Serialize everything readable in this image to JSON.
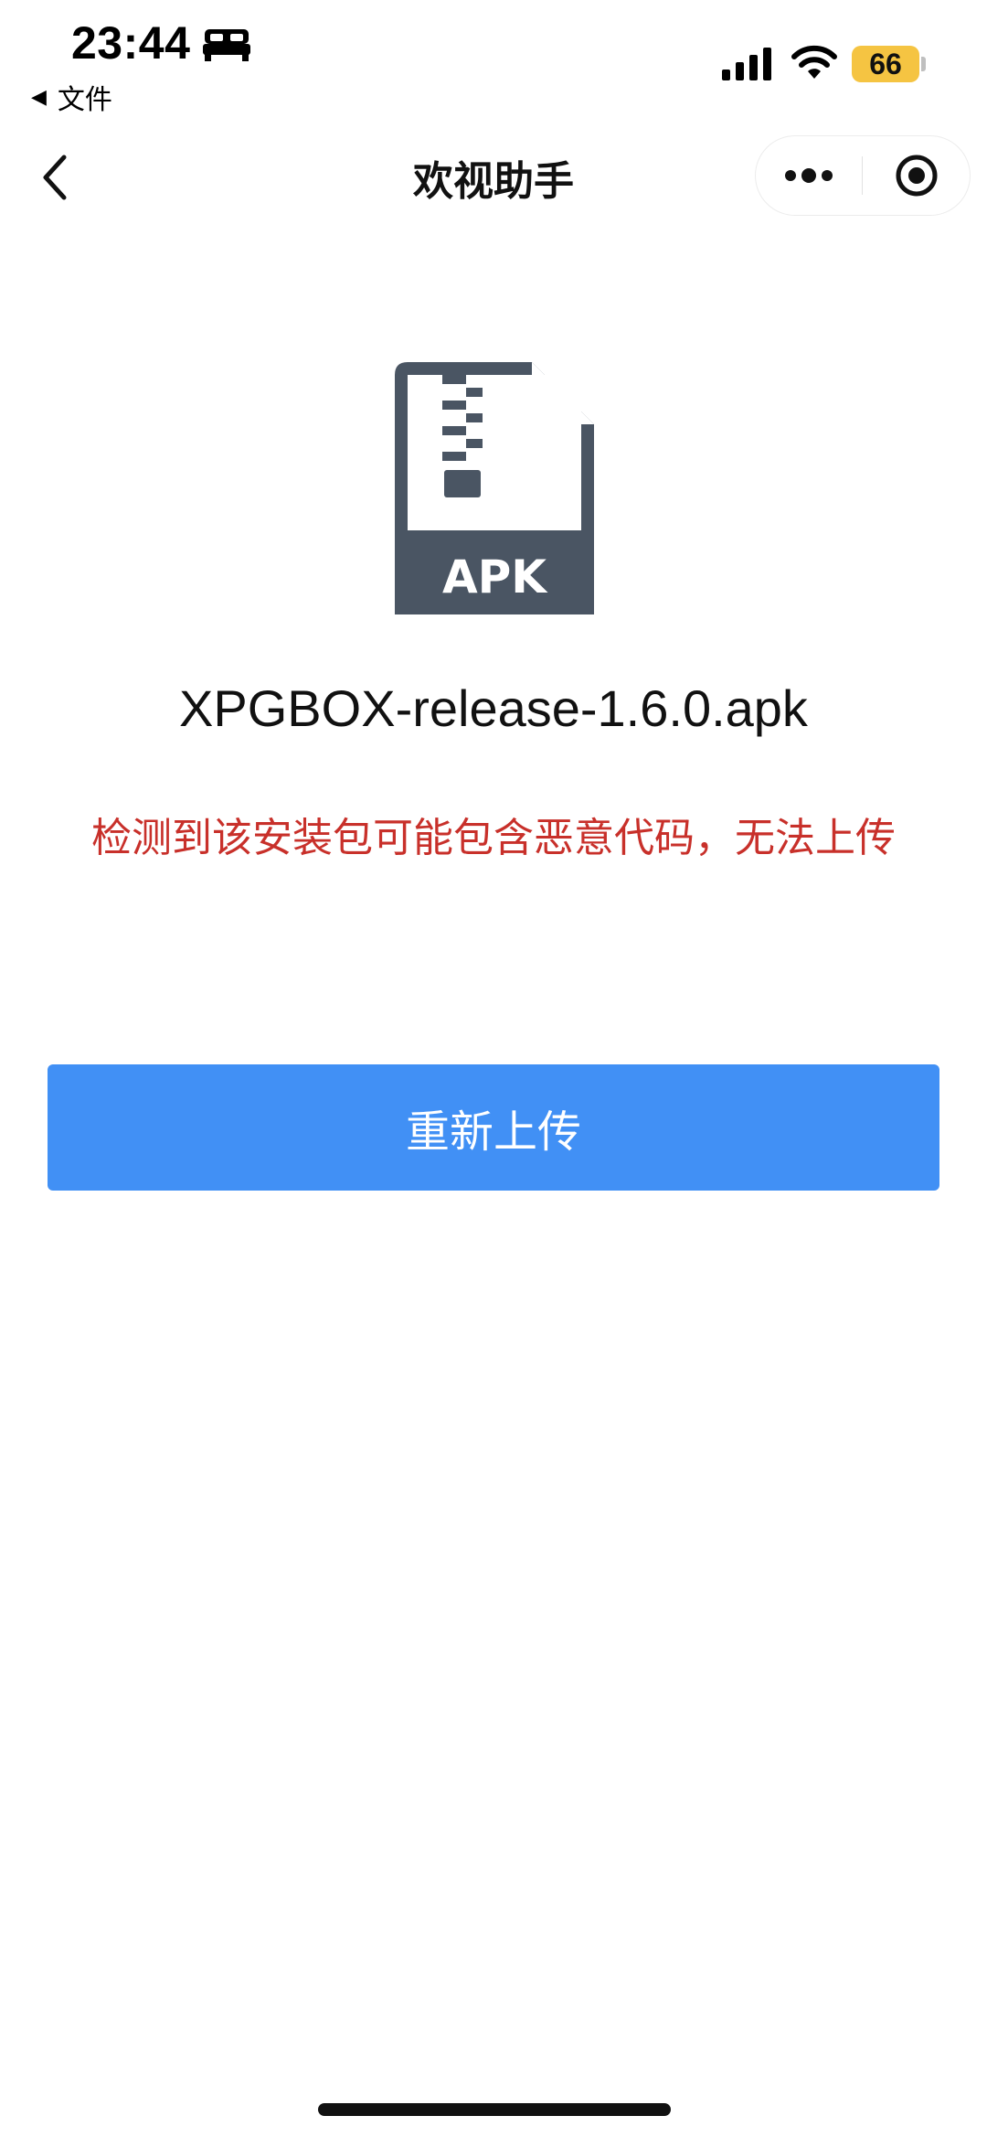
{
  "status_bar": {
    "time": "23:44",
    "back_app_label": "文件",
    "battery_level": "66",
    "icons": [
      "bed-icon",
      "signal-icon",
      "wifi-icon",
      "battery-icon"
    ]
  },
  "nav": {
    "title": "欢视助手",
    "icons": [
      "chevron-left-icon",
      "more-icon",
      "close-target-icon"
    ]
  },
  "file": {
    "icon": "apk-file-icon",
    "icon_label": "APK",
    "name": "XPGBOX-release-1.6.0.apk"
  },
  "error_message": "检测到该安装包可能包含恶意代码，无法上传",
  "reupload_button_label": "重新上传",
  "colors": {
    "accent_blue": "#4190f5",
    "error_red": "#c8302a",
    "file_icon": "#4a5563",
    "battery_yellow": "#f5c442"
  }
}
